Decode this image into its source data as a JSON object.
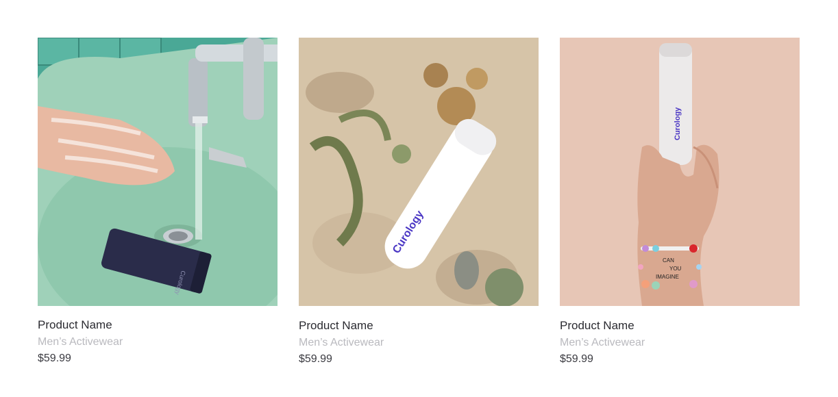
{
  "products": [
    {
      "name": "Product Name",
      "category": "Men’s Activewear",
      "price": "$59.99",
      "image_label": "Curology",
      "image_icon": "cleanser-tube-in-sink-photo"
    },
    {
      "name": "Product Name",
      "category": "Men’s Activewear",
      "price": "$59.99",
      "image_label": "Curology",
      "image_icon": "bottle-on-desert-sand-photo"
    },
    {
      "name": "Product Name",
      "category": "Men’s Activewear",
      "price": "$59.99",
      "image_label": "Curology",
      "image_icon": "hand-holding-bottle-photo",
      "bracelet_text": [
        "CAN",
        "YOU",
        "IMAGINE"
      ]
    }
  ],
  "colors": {
    "brand": "#4a36c4",
    "tile": "#3e9a8b",
    "sink": "#a8d3bd",
    "sand": "#d7c7ad",
    "peach": "#e7c6b6"
  }
}
